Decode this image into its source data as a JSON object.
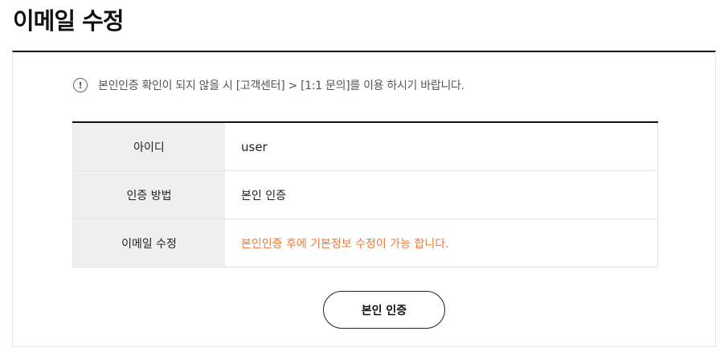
{
  "page": {
    "title": "이메일 수정"
  },
  "notice": {
    "icon": "exclamation-circle-icon",
    "icon_glyph": "!",
    "text": "본인인증 확인이 되지 않을 시 [고객센터] > [1:1 문의]를 이용 하시기 바랍니다."
  },
  "table": {
    "rows": [
      {
        "label": "아이디",
        "value": "user"
      },
      {
        "label": "인증 방법",
        "value": "본인 인증"
      },
      {
        "label": "이메일 수정",
        "value": "본인인증 후에 기본정보 수정이 가능 합니다."
      }
    ]
  },
  "actions": {
    "verify_label": "본인 인증"
  },
  "colors": {
    "accent_warning": "#ee7a3a",
    "label_background": "#efefef",
    "border_dark": "#111111"
  }
}
